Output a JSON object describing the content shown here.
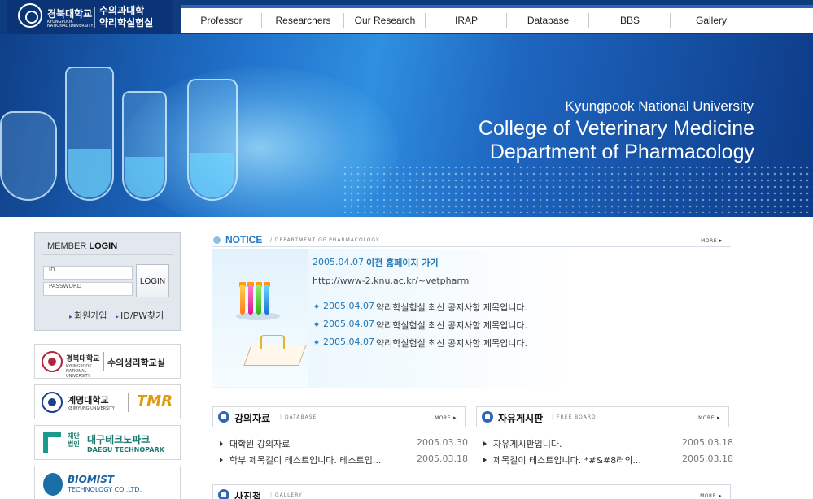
{
  "header": {
    "university_ko": "경북대학교",
    "university_en_1": "KYUNGPOOK",
    "university_en_2": "NATIONAL UNIVERSITY",
    "college_ko_1": "수의과대학",
    "college_ko_2": "약리학실험실"
  },
  "nav": {
    "items": [
      "Professor",
      "Researchers",
      "Our Research",
      "IRAP",
      "Database",
      "BBS",
      "Gallery"
    ]
  },
  "banner": {
    "line1": "Kyungpook National University",
    "line2": "College of Veterinary Medicine",
    "line3": "Department of Pharmacology"
  },
  "login": {
    "title_prefix": "MEMBER ",
    "title_bold": "LOGIN",
    "id_placeholder": "ID",
    "pw_placeholder": "PASSWORD",
    "button_label": "LOGIN",
    "join_label": "회원가입",
    "find_label": "ID/PW찾기"
  },
  "partners": {
    "p1_left": "경북대학교",
    "p1_sub": "KYUNGPOOK NATIONAL UNIVERSITY",
    "p1_right": "수의생리학교실",
    "p2_left": "계명대학교",
    "p2_sub": "KEIMYUNG UNIVERSITY",
    "p2_right": "TMR",
    "p3_prefix": "재단 법인",
    "p3_main": "대구테크노파크",
    "p3_sub": "DAEGU TECHNOPARK",
    "p4_main": "BIOMIST",
    "p4_sub": "TECHNOLOGY CO.,LTD."
  },
  "notice": {
    "title": "NOTICE",
    "subtitle": "/ DEPARTMENT OF PHARMACOLOGY",
    "more": "MORE",
    "featured_date": "2005.04.07",
    "featured_title": "이전 홈페이지 가기",
    "featured_url": "http://www-2.knu.ac.kr/~vetpharm",
    "rows": [
      {
        "date": "2005.04.07",
        "title": "약리학실험실 최신 공지사항 제목입니다."
      },
      {
        "date": "2005.04.07",
        "title": "약리학실험실 최신 공지사항 제목입니다."
      },
      {
        "date": "2005.04.07",
        "title": "약리학실험실 최신 공지사항 제목입니다."
      }
    ]
  },
  "lecture_board": {
    "title": "강의자료",
    "subtitle": "DATABASE",
    "more": "MORE",
    "rows": [
      {
        "title": "대학원 강의자료",
        "date": "2005.03.30"
      },
      {
        "title": "학부 제목길이 테스트입니다. 테스트입...",
        "date": "2005.03.18"
      }
    ]
  },
  "free_board": {
    "title": "자유게시판",
    "subtitle": "FREE BOARD",
    "more": "MORE",
    "rows": [
      {
        "title": "자유게시판입니다.",
        "date": "2005.03.18"
      },
      {
        "title": "제목길이 테스트입니다. *#&#8러의...",
        "date": "2005.03.18"
      }
    ]
  },
  "gallery_board": {
    "title": "사진첩",
    "subtitle": "GALLERY",
    "more": "MORE"
  },
  "colors": {
    "brand_navy": "#0d3b7e",
    "notice_blue": "#2577c5",
    "link_blue": "#1f76b6"
  }
}
